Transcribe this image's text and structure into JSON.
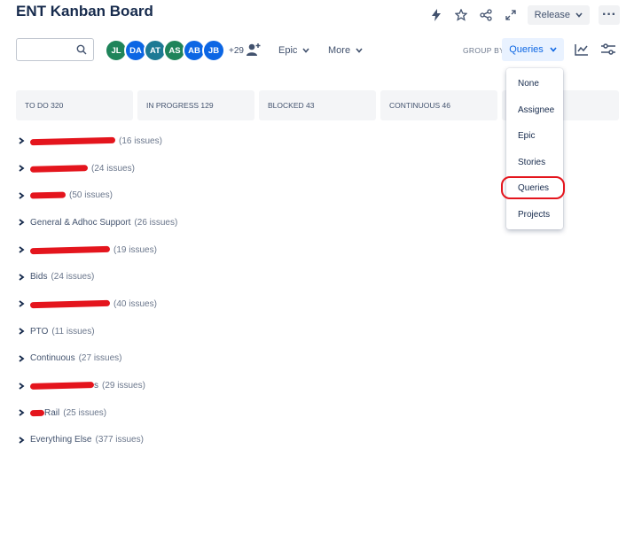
{
  "header": {
    "title": "ENT Kanban Board",
    "release_label": "Release",
    "more_label": "···"
  },
  "toolbar": {
    "search": {
      "value": "",
      "placeholder": ""
    },
    "avatars": [
      {
        "initials": "JL",
        "color": "#1f845a"
      },
      {
        "initials": "DA",
        "color": "#0c66e4"
      },
      {
        "initials": "AT",
        "color": "#1d7a94"
      },
      {
        "initials": "AS",
        "color": "#1f845a"
      },
      {
        "initials": "AB",
        "color": "#0c66e4"
      },
      {
        "initials": "JB",
        "color": "#0c66e4"
      }
    ],
    "avatars_more": "+29",
    "epic_label": "Epic",
    "more_filter_label": "More",
    "group_by_label": "GROUP BY",
    "group_by_value": "Queries"
  },
  "columns": [
    {
      "label": "TO DO 320"
    },
    {
      "label": "IN PROGRESS 129"
    },
    {
      "label": "BLOCKED 43"
    },
    {
      "label": "CONTINUOUS 46"
    },
    {
      "label": ""
    }
  ],
  "groups": [
    {
      "name": "",
      "redacted": true,
      "count": "(16 issues)"
    },
    {
      "name": "",
      "redacted": true,
      "count": "(24 issues)"
    },
    {
      "name": "",
      "redacted": true,
      "count": "(50 issues)"
    },
    {
      "name": "General & Adhoc Support",
      "redacted": false,
      "count": "(26 issues)"
    },
    {
      "name": "",
      "redacted": true,
      "count": "(19 issues)"
    },
    {
      "name": "Bids",
      "redacted": false,
      "count": "(24 issues)"
    },
    {
      "name": "",
      "redacted": true,
      "count": "(40 issues)"
    },
    {
      "name": "PTO",
      "redacted": false,
      "count": "(11 issues)"
    },
    {
      "name": "Continuous",
      "redacted": false,
      "count": "(27 issues)"
    },
    {
      "name": "s",
      "redacted": true,
      "count": "(29 issues)"
    },
    {
      "name": "Rail",
      "redacted": true,
      "count": "(25 issues)"
    },
    {
      "name": "Everything Else",
      "redacted": false,
      "count": "(377 issues)"
    }
  ],
  "group_by_menu": {
    "options": [
      "None",
      "Assignee",
      "Epic",
      "Stories",
      "Queries",
      "Projects"
    ],
    "selected": "Queries"
  },
  "colors": {
    "redaction": "#e4151d",
    "accent": "#0c66e4"
  }
}
